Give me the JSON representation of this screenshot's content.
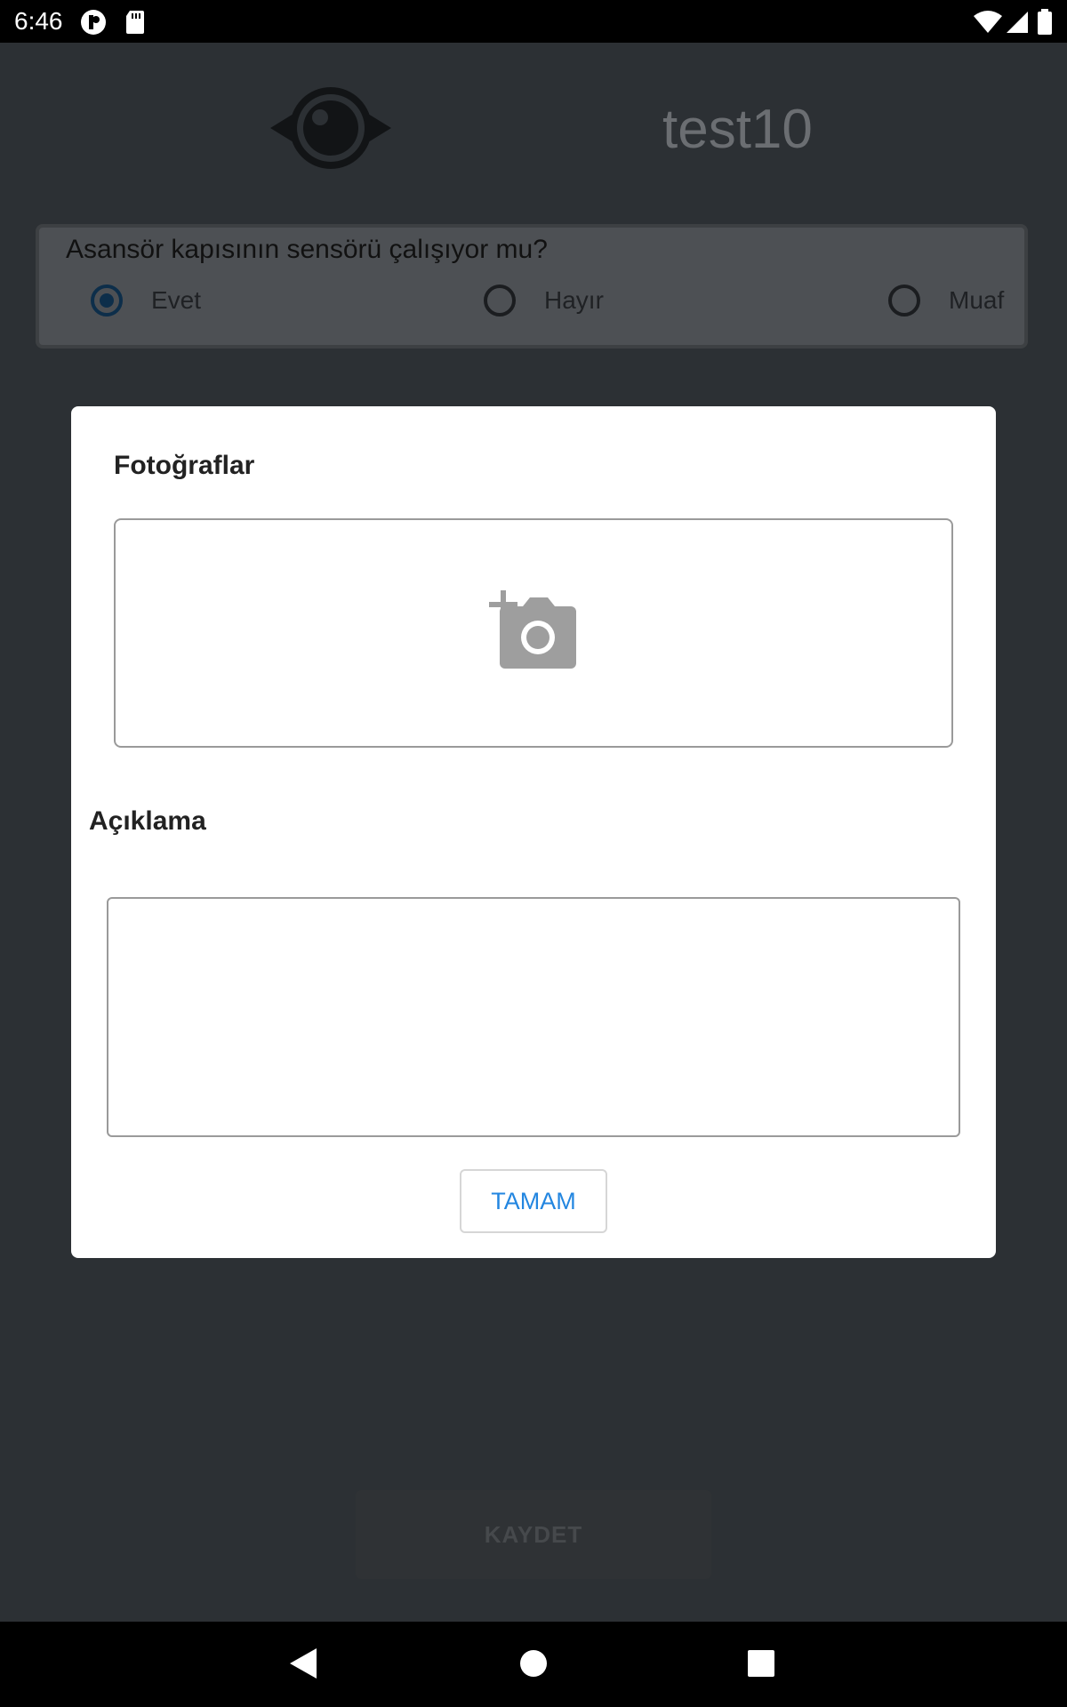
{
  "status_bar": {
    "time": "6:46"
  },
  "header": {
    "title": "test10",
    "logo_icon": "eye-logo-icon"
  },
  "question_card": {
    "question": "Asansör kapısının sensörü çalışıyor mu?",
    "options": [
      {
        "label": "Evet",
        "checked": true
      },
      {
        "label": "Hayır",
        "checked": false
      },
      {
        "label": "Muaf",
        "checked": false
      }
    ]
  },
  "dialog": {
    "photos_title": "Fotoğraflar",
    "add_photo_icon": "add-photo-camera-icon",
    "description_label": "Açıklama",
    "description_value": "",
    "ok_label": "TAMAM"
  },
  "save_button": {
    "label": "KAYDET"
  },
  "colors": {
    "accent": "#2386e0",
    "overlay_background": "#2c3034",
    "dialog_background": "#ffffff"
  }
}
